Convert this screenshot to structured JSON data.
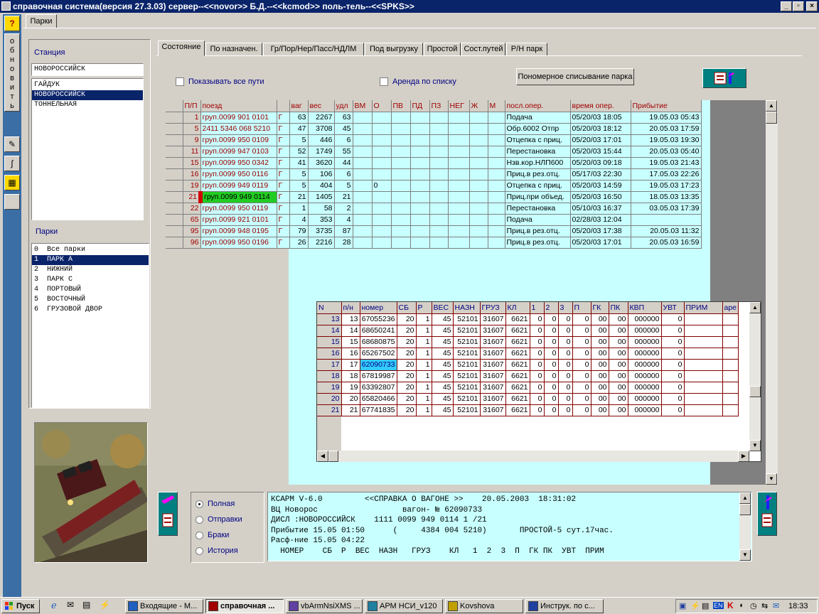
{
  "window": {
    "title": "справочная система(версия 27.3.03) сервер--<<novor>> Б.Д.--<<kcmod>> поль-тель--<<SPKS>>",
    "min_label": "_",
    "max_label": "▫",
    "close_label": "×"
  },
  "lefttool": {
    "help_label": "?",
    "refresh_label": "обновить"
  },
  "outer_tab": "Парки",
  "station": {
    "label": "Станция",
    "value": "НОВОРОССИЙСК",
    "items": [
      "ГАЙДУК",
      "НОВОРОССИЙСК",
      "ТОННЕЛЬНАЯ"
    ],
    "selected": 1
  },
  "parks": {
    "label": "Парки",
    "items": [
      "0  Все парки",
      "1  ПАРК А",
      "2  НИЖНИЙ",
      "3  ПАРК С",
      "4  ПОРТОВЫЙ",
      "5  ВОСТОЧНЫЙ",
      "6  ГРУЗОВОЙ ДВОР"
    ],
    "selected": 1
  },
  "tabs": [
    "Состояние",
    "По назначен.",
    "Гр/Пор/Нер/Пасс/НДЛМ",
    "Под выгрузку",
    "Простой",
    "Сост.путей",
    "Р/Н парк"
  ],
  "options": {
    "show_all": "Показывать  все пути",
    "rent": "Аренда по списку",
    "button": "Пономерное списывание парка"
  },
  "main_grid": {
    "track": "1",
    "headers": [
      "П/П",
      "поезд",
      "",
      "ваг",
      "вес",
      "удл",
      "ВМ",
      "О",
      "ПВ",
      "ПД",
      "ПЗ",
      "НЕГ",
      "Ж",
      "М",
      "посл.опер.",
      "время опер.",
      "Прибытие"
    ],
    "rows": [
      [
        "1",
        "груп.0099 901 0101",
        "Г",
        "63",
        "2267",
        "63",
        "",
        "",
        "",
        "",
        "",
        "",
        "",
        "",
        "Подача",
        "05/20/03 18:05",
        "19.05.03 05:43"
      ],
      [
        "5",
        "2411 5346 068 5210",
        "Г",
        "47",
        "3708",
        "45",
        "",
        "",
        "",
        "",
        "",
        "",
        "",
        "",
        "Обр.6002 Отпр",
        "05/20/03 18:12",
        "20.05.03 17:59"
      ],
      [
        "9",
        "груп.0099 950 0109",
        "Г",
        "5",
        "446",
        "6",
        "",
        "",
        "",
        "",
        "",
        "",
        "",
        "",
        "Отцепка с приц.",
        "05/20/03 17:01",
        "19.05.03 19:30"
      ],
      [
        "11",
        "груп.0099 947 0103",
        "Г",
        "52",
        "1749",
        "55",
        "",
        "",
        "",
        "",
        "",
        "",
        "",
        "",
        "Перестановка",
        "05/20/03 15:44",
        "20.05.03 05:40"
      ],
      [
        "15",
        "груп.0099 950 0342",
        "Г",
        "41",
        "3620",
        "44",
        "",
        "",
        "",
        "",
        "",
        "",
        "",
        "",
        "Нзв.кор.НЛП600",
        "05/20/03 09:18",
        "19.05.03 21:43"
      ],
      [
        "16",
        "груп.0099 950 0116",
        "Г",
        "5",
        "106",
        "6",
        "",
        "",
        "",
        "",
        "",
        "",
        "",
        "",
        "Приц.в рез.отц.",
        "05/17/03 22:30",
        "17.05.03 22:26"
      ],
      [
        "19",
        "груп.0099 949 0119",
        "Г",
        "5",
        "404",
        "5",
        "",
        "0",
        "",
        "",
        "",
        "",
        "",
        "",
        "Отцепка с приц.",
        "05/20/03 14:59",
        "19.05.03 17:23"
      ],
      [
        "21",
        "груп.0099 949 0114",
        "Г",
        "21",
        "1405",
        "21",
        "",
        "",
        "",
        "",
        "",
        "",
        "",
        "",
        "Приц.при объед.",
        "05/20/03 16:50",
        "18.05.03 13:35"
      ],
      [
        "22",
        "груп.0099 950 0119",
        "Г",
        "1",
        "58",
        "2",
        "",
        "",
        "",
        "",
        "",
        "",
        "",
        "",
        "Перестановка",
        "05/10/03 16:37",
        "03.05.03 17:39"
      ],
      [
        "65",
        "груп.0099 921 0101",
        "Г",
        "4",
        "353",
        "4",
        "",
        "",
        "",
        "",
        "",
        "",
        "",
        "",
        "Подача",
        "02/28/03 12:04",
        ""
      ],
      [
        "95",
        "груп.0099 948 0195",
        "Г",
        "79",
        "3735",
        "87",
        "",
        "",
        "",
        "",
        "",
        "",
        "",
        "",
        "Приц.в рез.отц.",
        "05/20/03 17:38",
        "20.05.03 11:32"
      ],
      [
        "96",
        "груп.0099 950 0196",
        "Г",
        "26",
        "2216",
        "28",
        "",
        "",
        "",
        "",
        "",
        "",
        "",
        "",
        "Приц.в рез.отц.",
        "05/20/03 17:01",
        "20.05.03 16:59"
      ]
    ],
    "selected_row": 7
  },
  "wagon_grid": {
    "headers": [
      "N",
      "п/н",
      "номер",
      "СБ",
      "Р",
      "ВЕС",
      "НАЗН",
      "ГРУЗ",
      "КЛ",
      "1",
      "2",
      "3",
      "П",
      "ГК",
      "ПК",
      "КВП",
      "УВТ",
      "ПРИМ",
      "аре"
    ],
    "rows": [
      [
        "13",
        "13",
        "67055236",
        "20",
        "1",
        "45",
        "52101",
        "31607",
        "6621",
        "0",
        "0",
        "0",
        "0",
        "00",
        "00",
        "000000",
        "0",
        "",
        ""
      ],
      [
        "14",
        "14",
        "68650241",
        "20",
        "1",
        "45",
        "52101",
        "31607",
        "6621",
        "0",
        "0",
        "0",
        "0",
        "00",
        "00",
        "000000",
        "0",
        "",
        ""
      ],
      [
        "15",
        "15",
        "68680875",
        "20",
        "1",
        "45",
        "52101",
        "31607",
        "6621",
        "0",
        "0",
        "0",
        "0",
        "00",
        "00",
        "000000",
        "0",
        "",
        ""
      ],
      [
        "16",
        "16",
        "65267502",
        "20",
        "1",
        "45",
        "52101",
        "31607",
        "6621",
        "0",
        "0",
        "0",
        "0",
        "00",
        "00",
        "000000",
        "0",
        "",
        ""
      ],
      [
        "17",
        "17",
        "62090733",
        "20",
        "1",
        "45",
        "52101",
        "31607",
        "6621",
        "0",
        "0",
        "0",
        "0",
        "00",
        "00",
        "000000",
        "0",
        "",
        ""
      ],
      [
        "18",
        "18",
        "67819987",
        "20",
        "1",
        "45",
        "52101",
        "31607",
        "6621",
        "0",
        "0",
        "0",
        "0",
        "00",
        "00",
        "000000",
        "0",
        "",
        ""
      ],
      [
        "19",
        "19",
        "63392807",
        "20",
        "1",
        "45",
        "52101",
        "31607",
        "6621",
        "0",
        "0",
        "0",
        "0",
        "00",
        "00",
        "000000",
        "0",
        "",
        ""
      ],
      [
        "20",
        "20",
        "65820466",
        "20",
        "1",
        "45",
        "52101",
        "31607",
        "6621",
        "0",
        "0",
        "0",
        "0",
        "00",
        "00",
        "000000",
        "0",
        "",
        ""
      ],
      [
        "21",
        "21",
        "67741835",
        "20",
        "1",
        "45",
        "52101",
        "31607",
        "6621",
        "0",
        "0",
        "0",
        "0",
        "00",
        "00",
        "000000",
        "0",
        "",
        ""
      ]
    ],
    "highlight_row": 4
  },
  "report_mode": {
    "items": [
      "Полная",
      "Отправки",
      "Браки",
      "История"
    ],
    "selected": 0
  },
  "info_text": [
    "КСАРМ V-6.0         <<СПРАВКА О ВАГОНЕ >>    20.05.2003  18:31:02",
    "ВЦ Новорос                  вагон- № 62090733",
    "ДИСЛ :НОВОРОССИЙСК    1111 0099 949 0114 1 /21",
    "Прибытие 15.05 01:50      (     4384 004 5210)       ПРОСТОЙ-5 сут.17час.",
    "Расф-ние 15.05 04:22",
    "  НОМЕР    СБ  Р  ВЕС  НАЗН   ГРУЗ    КЛ   1  2  3  П  ГК ПК  УВТ  ПРИМ"
  ],
  "taskbar": {
    "start": "Пуск",
    "items": [
      "Входящие - М...",
      "справочная ...",
      "vbArmNsiXMS ...",
      "АРМ НСИ_v120",
      "Kovshova",
      "Инструк. по с..."
    ],
    "active": 1,
    "lang": "EN",
    "clock": "18:33"
  },
  "colors": {
    "titlebar": "#0a246a",
    "grid_bg": "#c8ffff",
    "selected_train": "#22cc22",
    "highlight_cell": "#33ccff",
    "info_bg": "#c8ffff",
    "accent_red": "#a00000"
  }
}
